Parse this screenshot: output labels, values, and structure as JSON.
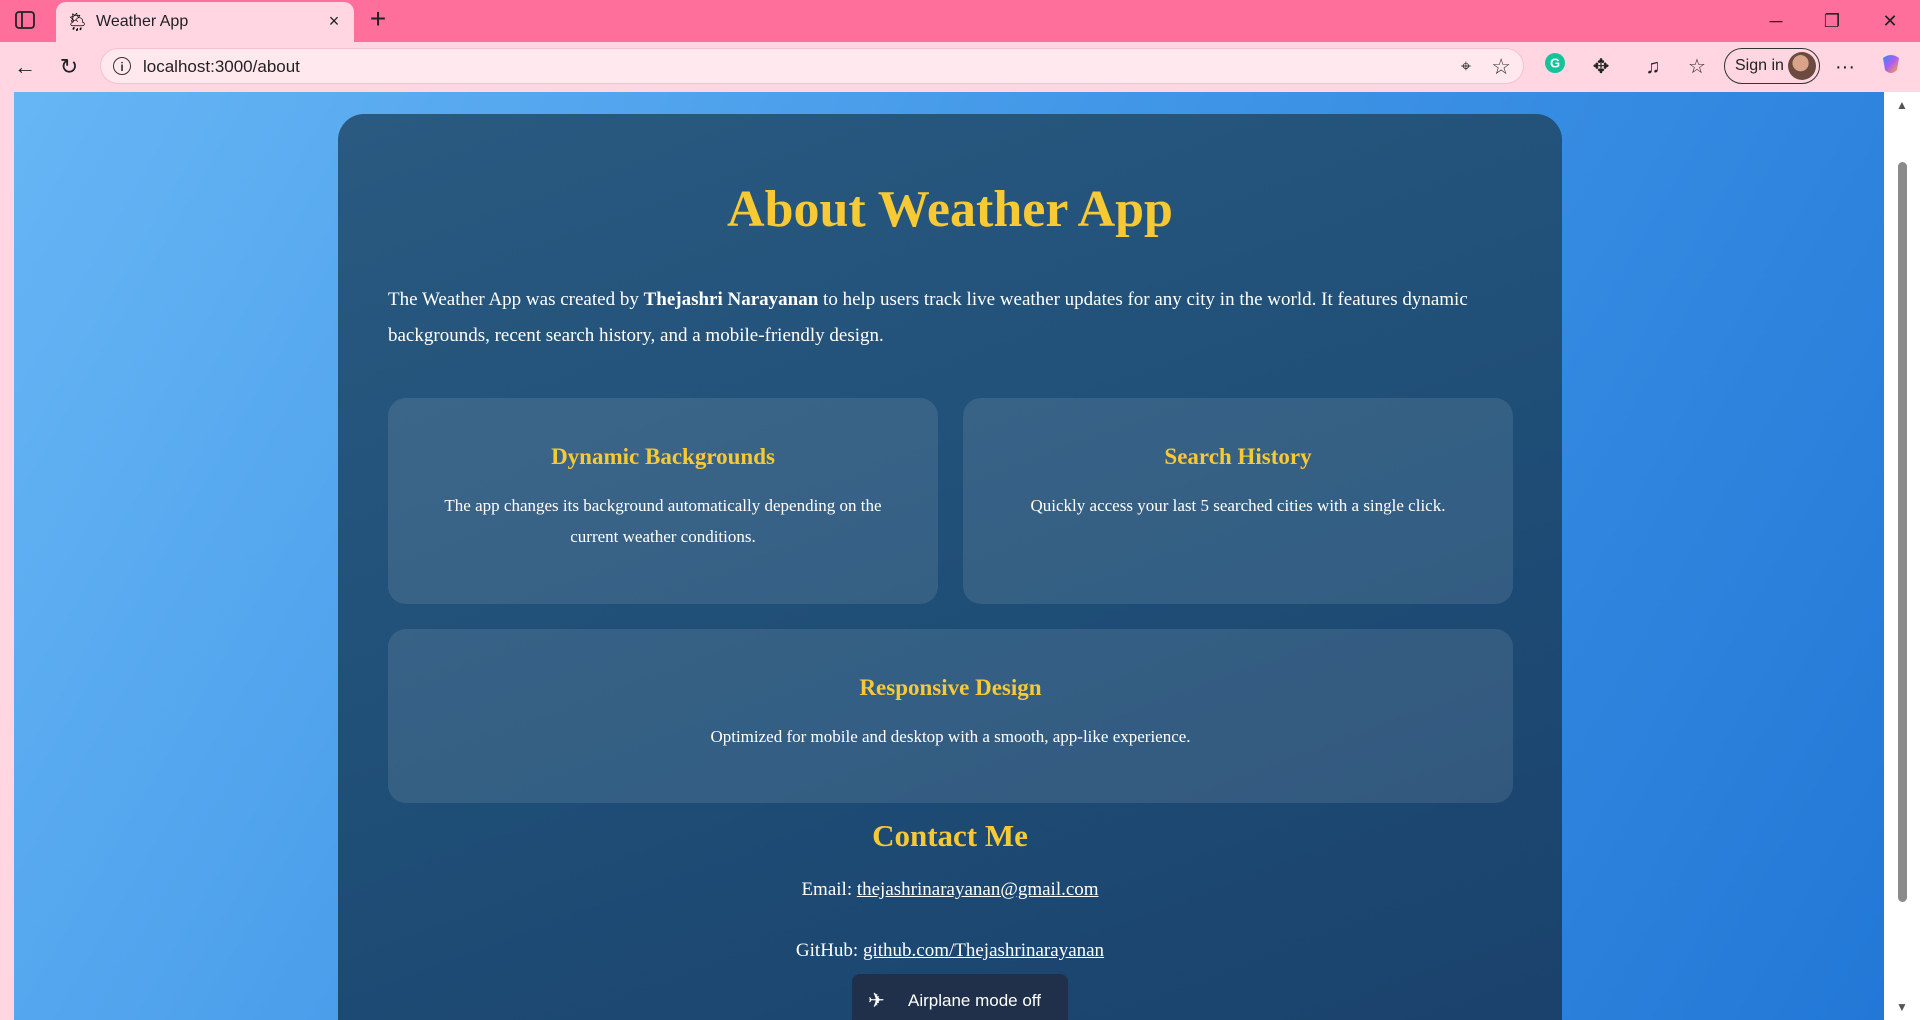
{
  "browser": {
    "tab_title": "Weather App",
    "tab_close": "×",
    "new_tab": "+",
    "url": "localhost:3000/about",
    "sign_in": "Sign in",
    "more": "···"
  },
  "page": {
    "title": "About Weather App",
    "intro_prefix": "The Weather App was created by ",
    "intro_author": "Thejashri Narayanan",
    "intro_suffix": " to help users track live weather updates for any city in the world. It features dynamic backgrounds, recent search history, and a mobile-friendly design.",
    "features": [
      {
        "title": "Dynamic Backgrounds",
        "text": "The app changes its background automatically depending on the current weather conditions."
      },
      {
        "title": "Search History",
        "text": "Quickly access your last 5 searched cities with a single click."
      },
      {
        "title": "Responsive Design",
        "text": "Optimized for mobile and desktop with a smooth, app-like experience."
      }
    ],
    "contact": {
      "title": "Contact Me",
      "email_label": "Email: ",
      "email": "thejashrinarayanan@gmail.com",
      "github_label": "GitHub: ",
      "github": "github.com/Thejashrinarayanan"
    }
  },
  "toast": {
    "message": "Airplane mode off"
  },
  "colors": {
    "accent": "#f7c934",
    "browser_chrome": "#ff6f9c",
    "card": "#1e4d76"
  }
}
